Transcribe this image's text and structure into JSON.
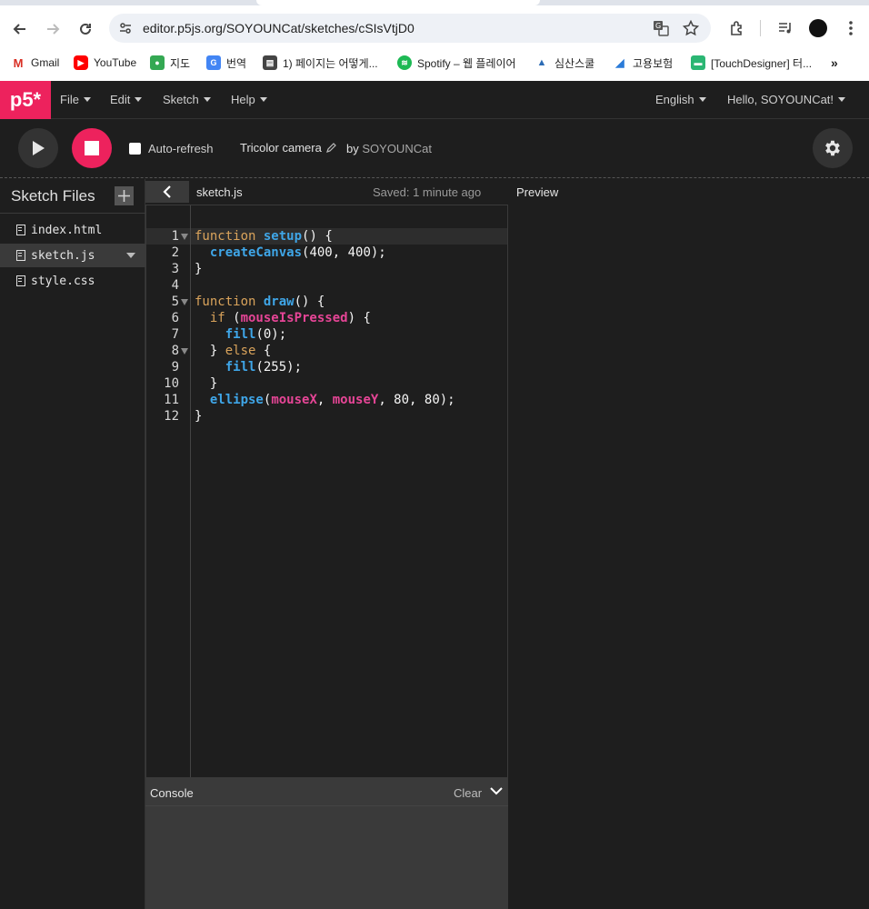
{
  "browser": {
    "url": "editor.p5js.org/SOYOUNCat/sketches/cSIsVtjD0",
    "bookmarks": [
      {
        "label": "Gmail",
        "icon": "gmail-icon",
        "color": "#d93025"
      },
      {
        "label": "YouTube",
        "icon": "youtube-icon",
        "color": "#ff0000"
      },
      {
        "label": "지도",
        "icon": "maps-icon",
        "color": "#34a853"
      },
      {
        "label": "번역",
        "icon": "translate-icon",
        "color": "#4285f4"
      },
      {
        "label": "1) 페이지는 어떻게...",
        "icon": "docs-icon",
        "color": "#444444"
      },
      {
        "label": "Spotify – 웹 플레이어",
        "icon": "spotify-icon",
        "color": "#1db954"
      },
      {
        "label": "심산스쿨",
        "icon": "simsan-icon",
        "color": "#2d6cb5"
      },
      {
        "label": "고용보험",
        "icon": "insurance-icon",
        "color": "#2b7bd8"
      },
      {
        "label": "[TouchDesigner] 터...",
        "icon": "touchdesigner-icon",
        "color": "#2bb673"
      }
    ]
  },
  "nav": {
    "logo": "p5*",
    "menus": [
      "File",
      "Edit",
      "Sketch",
      "Help"
    ],
    "language": "English",
    "user": "Hello, SOYOUNCat!"
  },
  "toolbar": {
    "autorefresh_label": "Auto-refresh",
    "sketch_name": "Tricolor camera",
    "by_label": "by",
    "author": "SOYOUNCat"
  },
  "sidebar": {
    "title": "Sketch Files",
    "files": [
      {
        "name": "index.html",
        "selected": false
      },
      {
        "name": "sketch.js",
        "selected": true
      },
      {
        "name": "style.css",
        "selected": false
      }
    ]
  },
  "editor": {
    "filename": "sketch.js",
    "saved_status": "Saved: 1 minute ago",
    "line_numbers": [
      "1",
      "2",
      "3",
      "4",
      "5",
      "6",
      "7",
      "8",
      "9",
      "10",
      "11",
      "12"
    ],
    "code_lines": [
      "function setup() {",
      "  createCanvas(400, 400);",
      "}",
      "",
      "function draw() {",
      "  if (mouseIsPressed) {",
      "    fill(0);",
      "  } else {",
      "    fill(255);",
      "  }",
      "  ellipse(mouseX, mouseY, 80, 80);",
      "}"
    ]
  },
  "console": {
    "title": "Console",
    "clear_label": "Clear"
  },
  "preview": {
    "title": "Preview"
  }
}
